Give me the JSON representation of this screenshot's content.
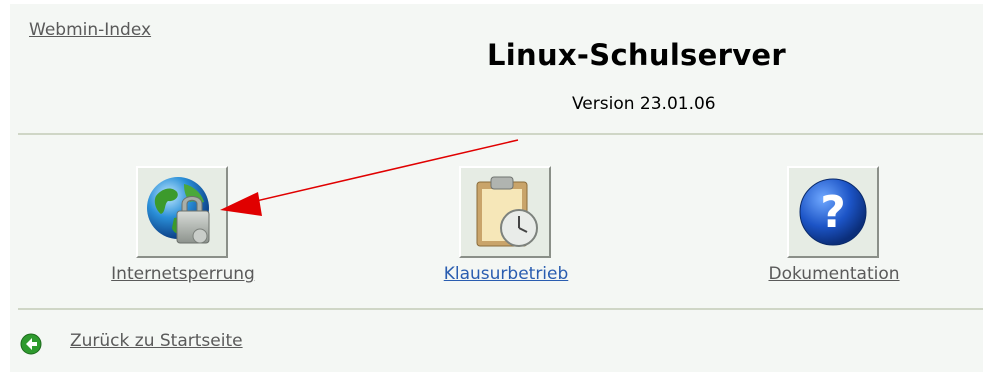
{
  "header": {
    "index_link": "Webmin-Index",
    "title": "Linux-Schulserver",
    "version": "Version 23.01.06"
  },
  "modules": [
    {
      "label": "Internetsperrung",
      "icon": "globe-lock-icon"
    },
    {
      "label": "Klausurbetrieb",
      "icon": "clipboard-clock-icon"
    },
    {
      "label": "Dokumentation",
      "icon": "help-question-icon"
    }
  ],
  "footer": {
    "back_link": "Zurück zu Startseite",
    "back_icon": "back-arrow-icon"
  },
  "colors": {
    "background": "#f4f7f4",
    "divider": "#cfd6c6",
    "link": "#5a5a5a",
    "link_active": "#2a5db0",
    "annotation_arrow": "#e00000"
  }
}
